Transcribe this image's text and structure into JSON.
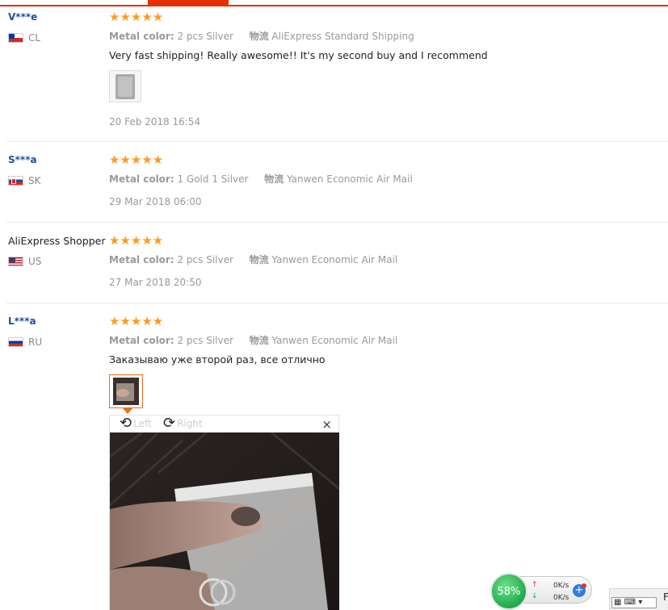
{
  "reviews": [
    {
      "buyer": "V***e",
      "country": "CL",
      "rating": "★★★★★",
      "metal_label": "Metal color:",
      "metal_value": "2 pcs Silver",
      "shipping_label": "物流",
      "shipping_value": "AliExpress Standard Shipping",
      "text": "Very fast shipping! Really awesome!! It's my second buy and I recommend",
      "date": "20 Feb 2018 16:54"
    },
    {
      "buyer": "S***a",
      "country": "SK",
      "rating": "★★★★★",
      "metal_label": "Metal color:",
      "metal_value": "1 Gold 1 Silver",
      "shipping_label": "物流",
      "shipping_value": "Yanwen Economic Air Mail",
      "date": "29 Mar 2018 06:00"
    },
    {
      "buyer": "AliExpress Shopper",
      "country": "US",
      "rating": "★★★★★",
      "metal_label": "Metal color:",
      "metal_value": "2 pcs Silver",
      "shipping_label": "物流",
      "shipping_value": "Yanwen Economic Air Mail",
      "date": "27 Mar 2018 20:50"
    },
    {
      "buyer": "L***a",
      "country": "RU",
      "rating": "★★★★★",
      "metal_label": "Metal color:",
      "metal_value": "2 pcs Silver",
      "shipping_label": "物流",
      "shipping_value": "Yanwen Economic Air Mail",
      "text": "Заказываю уже второй раз, все отлично"
    }
  ],
  "viewer": {
    "rotate_left_label": "Left",
    "rotate_right_label": "Right",
    "close_glyph": "×"
  },
  "net_monitor": {
    "percent": "58%",
    "upload": "0K/s",
    "download": "0K/s",
    "plus": "+"
  },
  "tray": {
    "letter": "F"
  },
  "colors": {
    "accent": "#e62e04",
    "star": "#ff9a1a",
    "buyer_link": "#1e50a2"
  }
}
